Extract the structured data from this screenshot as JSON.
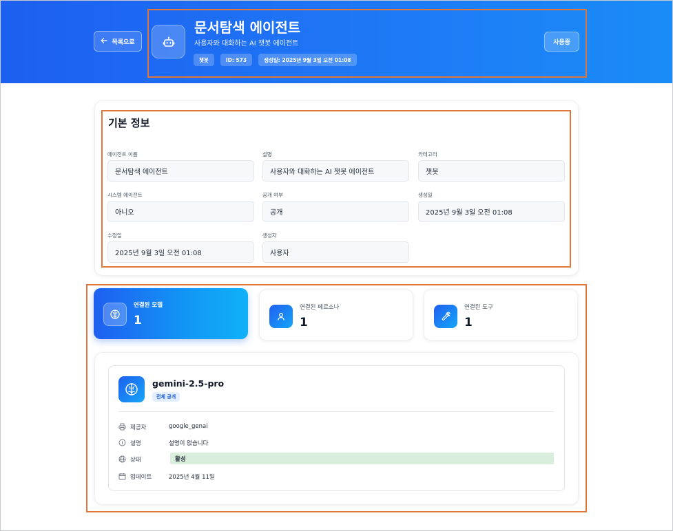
{
  "header": {
    "back_label": "목록으로",
    "title": "문서탐색 에이전트",
    "subtitle": "사용자와 대화하는 AI 챗봇 에이전트",
    "badges": [
      "챗봇",
      "ID: 573",
      "생성일: 2025년 9월 3일 오전 01:08"
    ],
    "status_button": "사용중",
    "icon": "bot-icon"
  },
  "basic_info": {
    "title": "기본 정보",
    "fields": [
      {
        "label": "에이전트 이름",
        "value": "문서탐색 에이전트"
      },
      {
        "label": "설명",
        "value": "사용자와 대화하는 AI 챗봇 에이전트"
      },
      {
        "label": "카테고리",
        "value": "챗봇"
      },
      {
        "label": "시스템 에이전트",
        "value": "아니오"
      },
      {
        "label": "공개 여부",
        "value": "공개"
      },
      {
        "label": "생성일",
        "value": "2025년 9월 3일 오전 01:08"
      },
      {
        "label": "수정일",
        "value": "2025년 9월 3일 오전 01:08"
      },
      {
        "label": "생성자",
        "value": "사용자"
      }
    ]
  },
  "stats": [
    {
      "label": "연결된 모델",
      "value": "1",
      "icon": "brain-icon",
      "active": true
    },
    {
      "label": "연결된 페르소나",
      "value": "1",
      "icon": "user-icon",
      "active": false
    },
    {
      "label": "연결된 도구",
      "value": "1",
      "icon": "wrench-icon",
      "active": false
    }
  ],
  "model": {
    "name": "gemini-2.5-pro",
    "visibility_badge": "전체 공개",
    "icon": "brain-icon",
    "properties": [
      {
        "label": "제공자",
        "value": "google_genai",
        "icon": "printer-icon"
      },
      {
        "label": "설명",
        "value": "설명이 없습니다",
        "icon": "info-icon"
      },
      {
        "label": "상태",
        "value": "활성",
        "icon": "globe-icon"
      },
      {
        "label": "업데이트",
        "value": "2025년 4월 11일",
        "icon": "calendar-icon"
      }
    ]
  },
  "colors": {
    "primary": "#1e6ef3",
    "highlight_outline": "#e0773a",
    "status_active_bg": "#d9eedd"
  }
}
